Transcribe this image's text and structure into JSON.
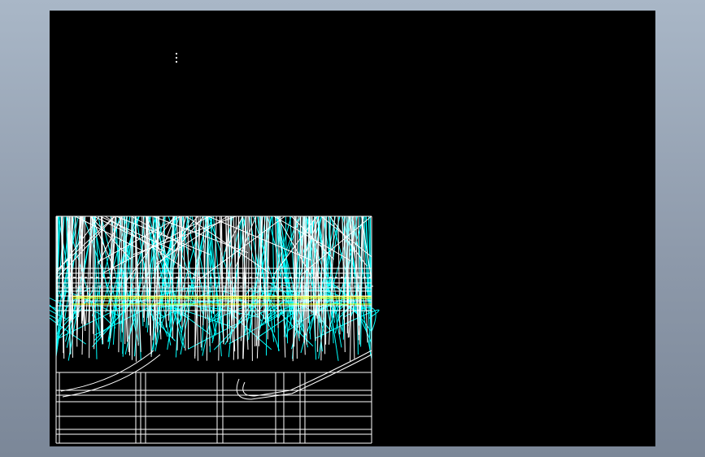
{
  "viewport": {
    "background_top": "#a9b7c7",
    "background_bottom": "#7b8798"
  },
  "sheet": {
    "background": "#000000"
  },
  "drawing": {
    "view": "wireframe",
    "line_colors": {
      "primary": "#ffffff",
      "secondary": "#00ffff",
      "accent": "#ffff00"
    }
  }
}
